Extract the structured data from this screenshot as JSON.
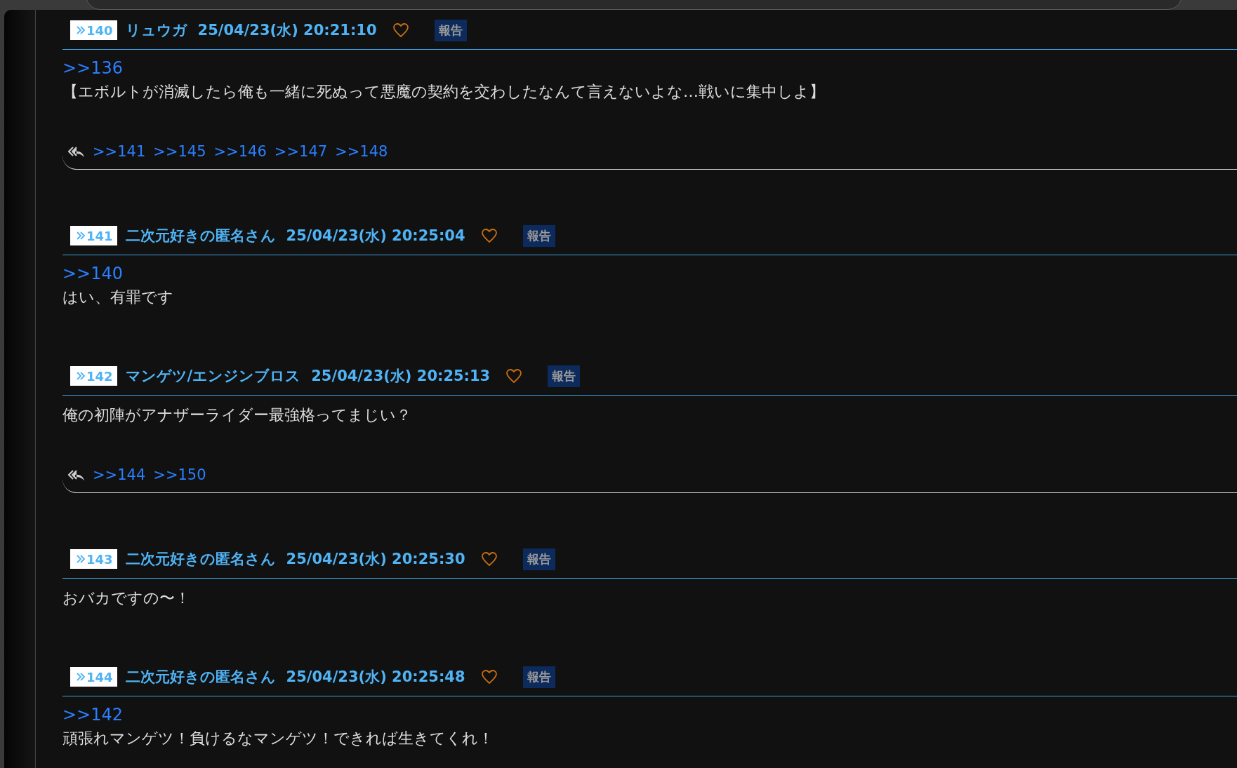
{
  "posts": [
    {
      "number": "140",
      "name": "リュウガ",
      "datetime": "25/04/23(水) 20:21:10",
      "report": "報告",
      "anchor": ">>136",
      "body": "【エボルトが消滅したら俺も一緒に死ぬって悪魔の契約を交わしたなんて言えないよな…戦いに集中しよ】",
      "replies": [
        ">>141",
        ">>145",
        ">>146",
        ">>147",
        ">>148"
      ]
    },
    {
      "number": "141",
      "name": "二次元好きの匿名さん",
      "datetime": "25/04/23(水) 20:25:04",
      "report": "報告",
      "anchor": ">>140",
      "body": "はい、有罪です"
    },
    {
      "number": "142",
      "name": "マンゲツ/エンジンブロス",
      "datetime": "25/04/23(水) 20:25:13",
      "report": "報告",
      "body": "俺の初陣がアナザーライダー最強格ってまじい？",
      "replies": [
        ">>144",
        ">>150"
      ]
    },
    {
      "number": "143",
      "name": "二次元好きの匿名さん",
      "datetime": "25/04/23(水) 20:25:30",
      "report": "報告",
      "body": "おバカですの〜！"
    },
    {
      "number": "144",
      "name": "二次元好きの匿名さん",
      "datetime": "25/04/23(水) 20:25:48",
      "report": "報告",
      "anchor": ">>142",
      "body": "頑張れマンゲツ！負けるなマンゲツ！できれば生きてくれ！"
    }
  ]
}
